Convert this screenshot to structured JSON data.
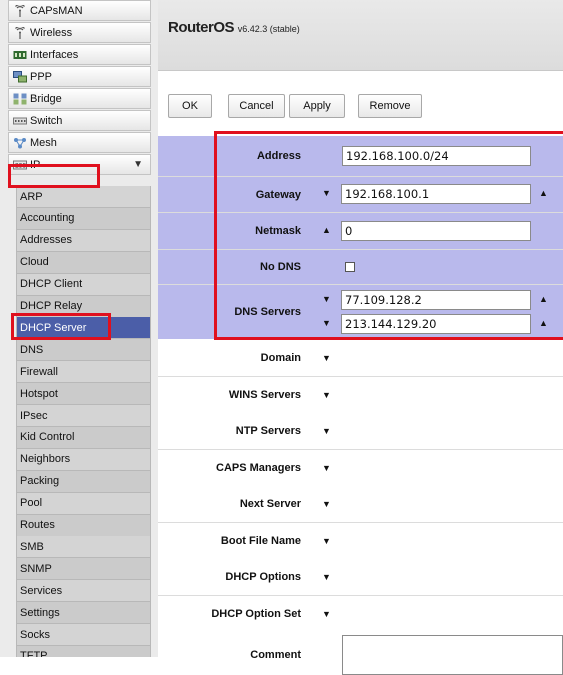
{
  "sidebar": {
    "top_items": [
      {
        "label": "CAPsMAN",
        "icon": "antenna-icon"
      },
      {
        "label": "Wireless",
        "icon": "antenna-icon"
      },
      {
        "label": "Interfaces",
        "icon": "interfaces-icon"
      },
      {
        "label": "PPP",
        "icon": "ppp-icon"
      },
      {
        "label": "Bridge",
        "icon": "bridge-icon"
      },
      {
        "label": "Switch",
        "icon": "switch-icon"
      },
      {
        "label": "Mesh",
        "icon": "mesh-icon"
      },
      {
        "label": "IP",
        "icon": "ip-icon",
        "arrow": "▼"
      }
    ],
    "sub_items": [
      "ARP",
      "Accounting",
      "Addresses",
      "Cloud",
      "DHCP Client",
      "DHCP Relay",
      "DHCP Server",
      "DNS",
      "Firewall",
      "Hotspot",
      "IPsec",
      "Kid Control",
      "Neighbors",
      "Packing",
      "Pool",
      "Routes",
      "SMB",
      "SNMP",
      "Services",
      "Settings",
      "Socks",
      "TFTP"
    ],
    "selected": "DHCP Server"
  },
  "header": {
    "title": "RouterOS",
    "version": "v6.42.3 (stable)"
  },
  "toolbar": {
    "ok": "OK",
    "cancel": "Cancel",
    "apply": "Apply",
    "remove": "Remove"
  },
  "form": {
    "address": {
      "label": "Address",
      "value": "192.168.100.0/24"
    },
    "gateway": {
      "label": "Gateway",
      "value": "192.168.100.1"
    },
    "netmask": {
      "label": "Netmask",
      "value": "0"
    },
    "no_dns": {
      "label": "No DNS",
      "checked": false
    },
    "dns_servers": {
      "label": "DNS Servers",
      "values": [
        "77.109.128.2",
        "213.144.129.20"
      ]
    },
    "domain": {
      "label": "Domain"
    },
    "wins_servers": {
      "label": "WINS Servers"
    },
    "ntp_servers": {
      "label": "NTP Servers"
    },
    "caps_managers": {
      "label": "CAPS Managers"
    },
    "next_server": {
      "label": "Next Server"
    },
    "boot_file_name": {
      "label": "Boot File Name"
    },
    "dhcp_options": {
      "label": "DHCP Options"
    },
    "dhcp_option_set": {
      "label": "DHCP Option Set"
    },
    "comment": {
      "label": "Comment",
      "value": ""
    }
  },
  "colors": {
    "highlight": "#e0101e",
    "selected_bg": "#4b5ea8",
    "row_bg": "#b9b9ec"
  }
}
